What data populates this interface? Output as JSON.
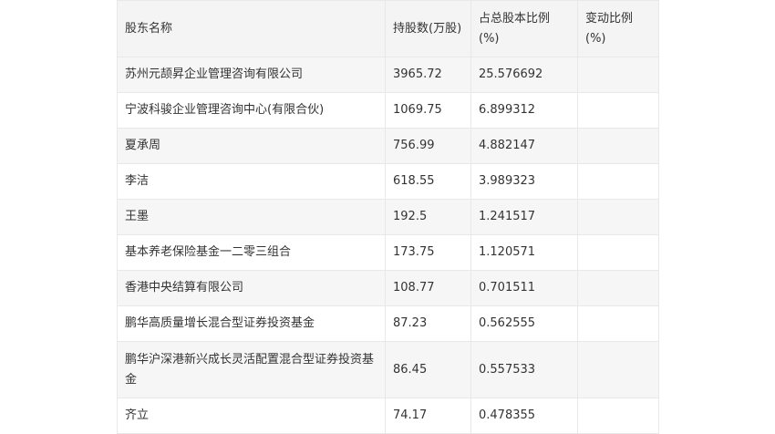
{
  "table": {
    "headers": [
      "股东名称",
      "持股数(万股)",
      "占总股本比例(%)",
      "变动比例(%)"
    ],
    "rows": [
      {
        "name": "苏州元颉昇企业管理咨询有限公司",
        "shares": "3965.72",
        "ratio": "25.576692",
        "change": ""
      },
      {
        "name": "宁波科骏企业管理咨询中心(有限合伙)",
        "shares": "1069.75",
        "ratio": "6.899312",
        "change": ""
      },
      {
        "name": "夏承周",
        "shares": "756.99",
        "ratio": "4.882147",
        "change": ""
      },
      {
        "name": "李洁",
        "shares": "618.55",
        "ratio": "3.989323",
        "change": ""
      },
      {
        "name": "王墨",
        "shares": "192.5",
        "ratio": "1.241517",
        "change": ""
      },
      {
        "name": "基本养老保险基金一二零三组合",
        "shares": "173.75",
        "ratio": "1.120571",
        "change": ""
      },
      {
        "name": "香港中央结算有限公司",
        "shares": "108.77",
        "ratio": "0.701511",
        "change": ""
      },
      {
        "name": "鹏华高质量增长混合型证券投资基金",
        "shares": "87.23",
        "ratio": "0.562555",
        "change": ""
      },
      {
        "name": "鹏华沪深港新兴成长灵活配置混合型证券投资基金",
        "shares": "86.45",
        "ratio": "0.557533",
        "change": ""
      },
      {
        "name": "齐立",
        "shares": "74.17",
        "ratio": "0.478355",
        "change": ""
      }
    ]
  }
}
